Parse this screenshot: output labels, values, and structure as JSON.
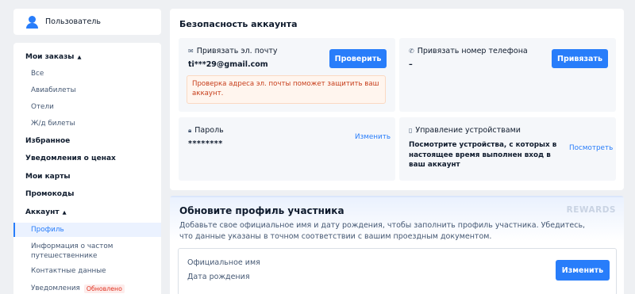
{
  "sidebar": {
    "user_name": "Пользователь",
    "items": [
      {
        "label": "Мои заказы",
        "type": "bold",
        "caret": "▲"
      },
      {
        "label": "Все",
        "type": "sub"
      },
      {
        "label": "Авиабилеты",
        "type": "sub"
      },
      {
        "label": "Отели",
        "type": "sub"
      },
      {
        "label": "Ж/д билеты",
        "type": "sub"
      },
      {
        "label": "Избранное",
        "type": "bold"
      },
      {
        "label": "Уведомления о ценах",
        "type": "bold"
      },
      {
        "label": "Мои карты",
        "type": "bold"
      },
      {
        "label": "Промокоды",
        "type": "bold"
      },
      {
        "label": "Аккаунт",
        "type": "bold",
        "caret": "▲"
      },
      {
        "label": "Профиль",
        "type": "sub",
        "active": true
      },
      {
        "label": "Информация о частом путешественнике",
        "type": "sub"
      },
      {
        "label": "Контактные данные",
        "type": "sub"
      },
      {
        "label": "Уведомления",
        "type": "sub",
        "badge": "Обновлено"
      }
    ]
  },
  "security": {
    "title": "Безопасность аккаунта",
    "email": {
      "icon": "mail-icon",
      "label": "Привязать эл. почту",
      "value": "ti***29@gmail.com",
      "button": "Проверить",
      "warning": "Проверка адреса эл. почты поможет защитить ваш аккаунт."
    },
    "phone": {
      "icon": "phone-icon",
      "label": "Привязать номер телефона",
      "value": "–",
      "button": "Привязать"
    },
    "password": {
      "icon": "lock-icon",
      "label": "Пароль",
      "value": "********",
      "link": "Изменить"
    },
    "devices": {
      "icon": "device-icon",
      "label": "Управление устройствами",
      "desc": "Посмотрите устройства, с которых в настоящее время выполнен вход в ваш аккаунт",
      "link": "Посмотреть"
    }
  },
  "profile": {
    "title": "Обновите профиль участника",
    "rewards_logo": "REWARDS",
    "desc": "Добавьте свое официальное имя и дату рождения, чтобы заполнить профиль участника. Убедитесь, что данные указаны в точном соответствии с вашим проездным документом.",
    "name_label": "Официальное имя",
    "birth_label": "Дата рождения",
    "button": "Изменить"
  },
  "colors": {
    "accent": "#287dfa",
    "warning_text": "#c63d1a",
    "badge": "#e0301e"
  }
}
